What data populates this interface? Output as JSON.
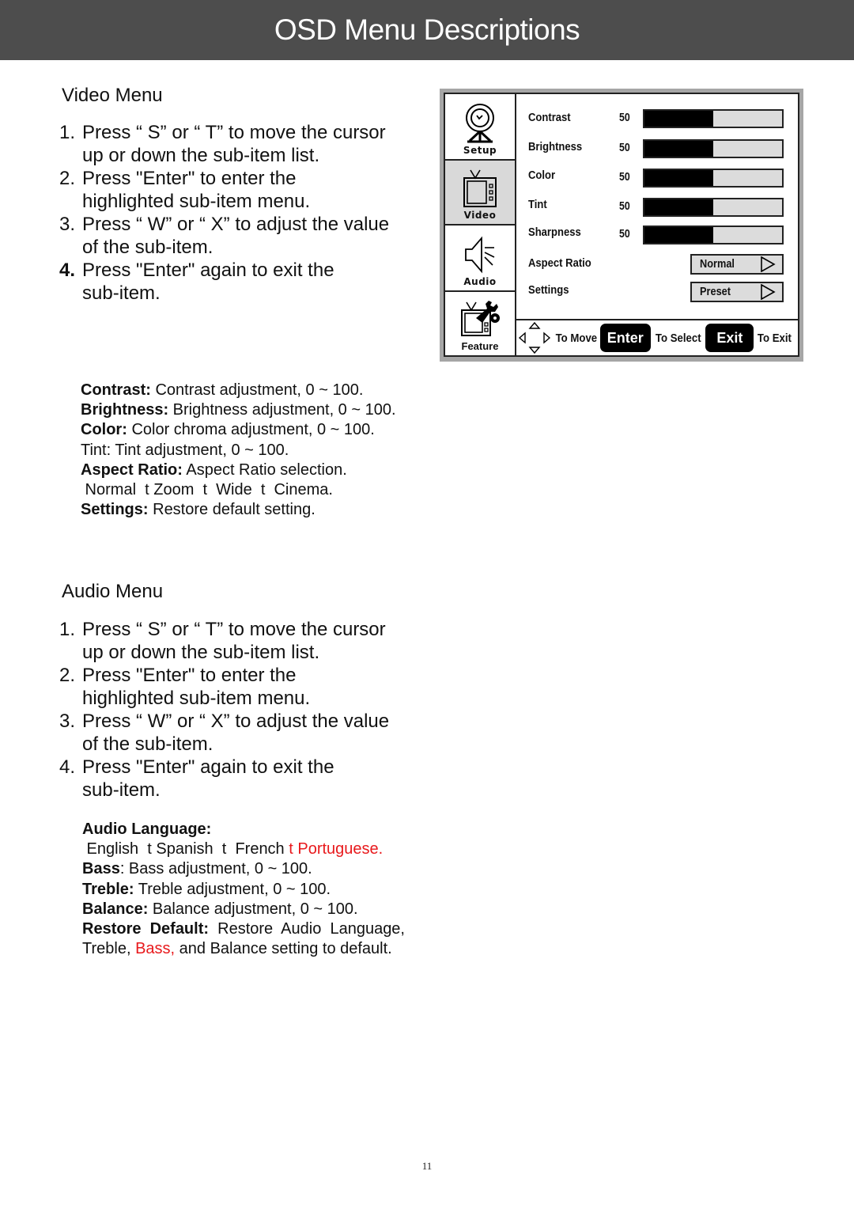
{
  "header": {
    "title": "OSD Menu Descriptions"
  },
  "video_menu": {
    "title": "Video Menu",
    "steps": [
      {
        "num": "1.",
        "lines": [
          "Press “ S” or “ T” to move the cursor",
          "up or down the sub-item list."
        ]
      },
      {
        "num": "2.",
        "lines": [
          "Press \"Enter\" to enter the",
          "highlighted sub-item menu."
        ]
      },
      {
        "num": "3.",
        "lines": [
          "Press “ W” or “ X” to adjust the value",
          "of the sub-item."
        ]
      },
      {
        "num": "4.",
        "lines": [
          "Press \"Enter\" again to exit the",
          "sub-item."
        ]
      }
    ],
    "descriptions": [
      {
        "term": "Contrast:",
        "text": " Contrast adjustment, 0 ~ 100."
      },
      {
        "term": "Brightness:",
        "text": " Brightness adjustment, 0 ~ 100."
      },
      {
        "term": "Color:",
        "text": " Color chroma adjustment, 0 ~ 100."
      },
      {
        "term": "",
        "text": "Tint: Tint adjustment, 0 ~ 100."
      },
      {
        "term": "Aspect Ratio:",
        "text": " Aspect Ratio selection."
      },
      {
        "term": "",
        "text": " Normal  t Zoom  t  Wide  t  Cinema."
      },
      {
        "term": "Settings:",
        "text": " Restore default setting."
      }
    ]
  },
  "osd": {
    "sidebar": [
      {
        "label": "Setup",
        "icon": "satellite-dish-icon",
        "active": false
      },
      {
        "label": "Video",
        "icon": "tv-icon",
        "active": true
      },
      {
        "label": "Audio",
        "icon": "speaker-icon",
        "active": false
      },
      {
        "label": "Feature",
        "icon": "tv-wrench-icon",
        "active": false
      }
    ],
    "sliders": [
      {
        "label": "Contrast",
        "value": "50",
        "level": 0.5
      },
      {
        "label": "Brightness",
        "value": "50",
        "level": 0.5
      },
      {
        "label": "Color",
        "value": "50",
        "level": 0.5
      },
      {
        "label": "Tint",
        "value": "50",
        "level": 0.5
      },
      {
        "label": "Sharpness",
        "value": "50",
        "level": 0.5
      }
    ],
    "selectors": [
      {
        "label": "Aspect Ratio",
        "value": "Normal"
      },
      {
        "label": "Settings",
        "value": "Preset"
      }
    ],
    "footer": {
      "move": "To Move",
      "enter_key": "Enter",
      "select": "To Select",
      "exit_key": "Exit",
      "exit": "To Exit"
    }
  },
  "audio_menu": {
    "title": "Audio Menu",
    "steps": [
      {
        "num": "1.",
        "lines": [
          "Press “ S” or “ T” to move the cursor",
          "up or down the sub-item list."
        ]
      },
      {
        "num": "2.",
        "lines": [
          "Press \"Enter\" to enter the",
          "highlighted sub-item menu."
        ]
      },
      {
        "num": "3.",
        "lines": [
          "Press “ W” or “ X” to adjust the value",
          "of the sub-item."
        ]
      },
      {
        "num": "4.",
        "lines": [
          "Press \"Enter\" again to exit the",
          "sub-item."
        ]
      }
    ],
    "language_term": "Audio Language:",
    "language_options": " English  t Spanish  t  French ",
    "language_options_red": "t Portuguese.",
    "descriptions": [
      {
        "term": "Bass",
        "text": ": Bass adjustment, 0 ~ 100."
      },
      {
        "term": "Treble:",
        "text": " Treble adjustment, 0 ~ 100."
      },
      {
        "term": "Balance:",
        "text": " Balance adjustment, 0 ~ 100."
      }
    ],
    "restore_term": "Restore  Default:",
    "restore_text": "  Restore  Audio  Language,",
    "restore_line2_a": "Treble, ",
    "restore_line2_red": "Bass,",
    "restore_line2_b": " and Balance setting to default."
  },
  "colors": {
    "header_bg": "#4d4d4d",
    "highlight_red": "#e8191c"
  },
  "page_number": "11"
}
